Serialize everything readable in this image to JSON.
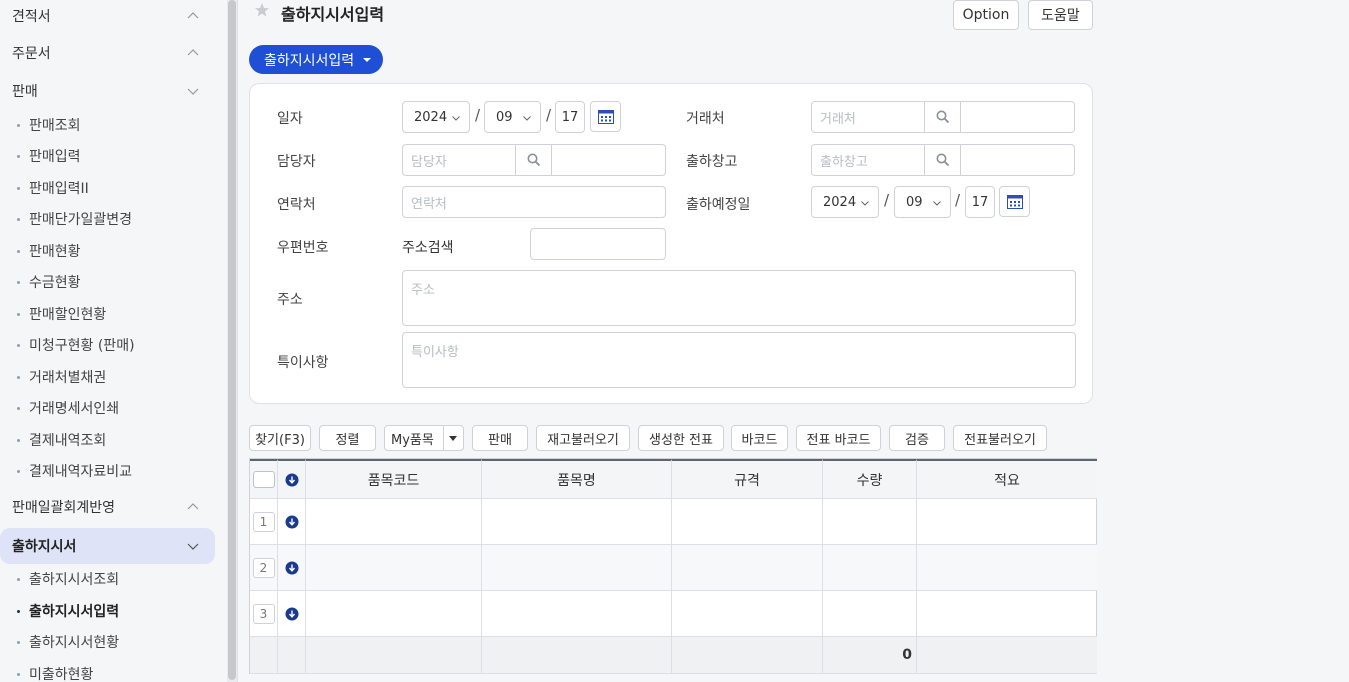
{
  "sidebar": {
    "sections": [
      {
        "label": "견적서",
        "expanded": false
      },
      {
        "label": "주문서",
        "expanded": false
      },
      {
        "label": "판매",
        "expanded": true
      },
      {
        "label": "판매일괄회계반영",
        "expanded": false
      },
      {
        "label": "출하지시서",
        "expanded": true
      }
    ],
    "sales_items": [
      "판매조회",
      "판매입력",
      "판매입력II",
      "판매단가일괄변경",
      "판매현황",
      "수금현황",
      "판매할인현황",
      "미청구현황 (판매)",
      "거래처별채권",
      "거래명세서인쇄",
      "결제내역조회",
      "결제내역자료비교"
    ],
    "shipping_items": [
      "출하지시서조회",
      "출하지시서입력",
      "출하지시서현황",
      "미출하현황"
    ]
  },
  "header": {
    "title": "출하지시서입력",
    "option_label": "Option",
    "help_label": "도움말",
    "menu_pill": "출하지시서입력"
  },
  "form": {
    "date_label": "일자",
    "date": {
      "year": "2024",
      "month": "09",
      "day": "17"
    },
    "client_label": "거래처",
    "client_placeholder": "거래처",
    "manager_label": "담당자",
    "manager_placeholder": "담당자",
    "warehouse_label": "출하창고",
    "warehouse_placeholder": "출하창고",
    "contact_label": "연락처",
    "contact_placeholder": "연락처",
    "ship_date_label": "출하예정일",
    "ship_date": {
      "year": "2024",
      "month": "09",
      "day": "17"
    },
    "zip_label": "우편번호",
    "address_search_label": "주소검색",
    "address_label": "주소",
    "address_placeholder": "주소",
    "remarks_label": "특이사항",
    "remarks_placeholder": "특이사항"
  },
  "toolbar": {
    "find": "찾기(F3)",
    "sort": "정렬",
    "my_items": "My품목",
    "sales": "판매",
    "load_stock": "재고불러오기",
    "created_slip": "생성한 전표",
    "barcode": "바코드",
    "slip_barcode": "전표 바코드",
    "verify": "검증",
    "load_slip": "전표불러오기"
  },
  "grid": {
    "columns": [
      "품목코드",
      "품목명",
      "규격",
      "수량",
      "적요"
    ],
    "rows": [
      "1",
      "2",
      "3"
    ],
    "total_quantity": "0"
  },
  "colors": {
    "accent": "#1f4fd4",
    "active_section": "#dfe3f7",
    "row_icon": "#1a3a8f"
  }
}
